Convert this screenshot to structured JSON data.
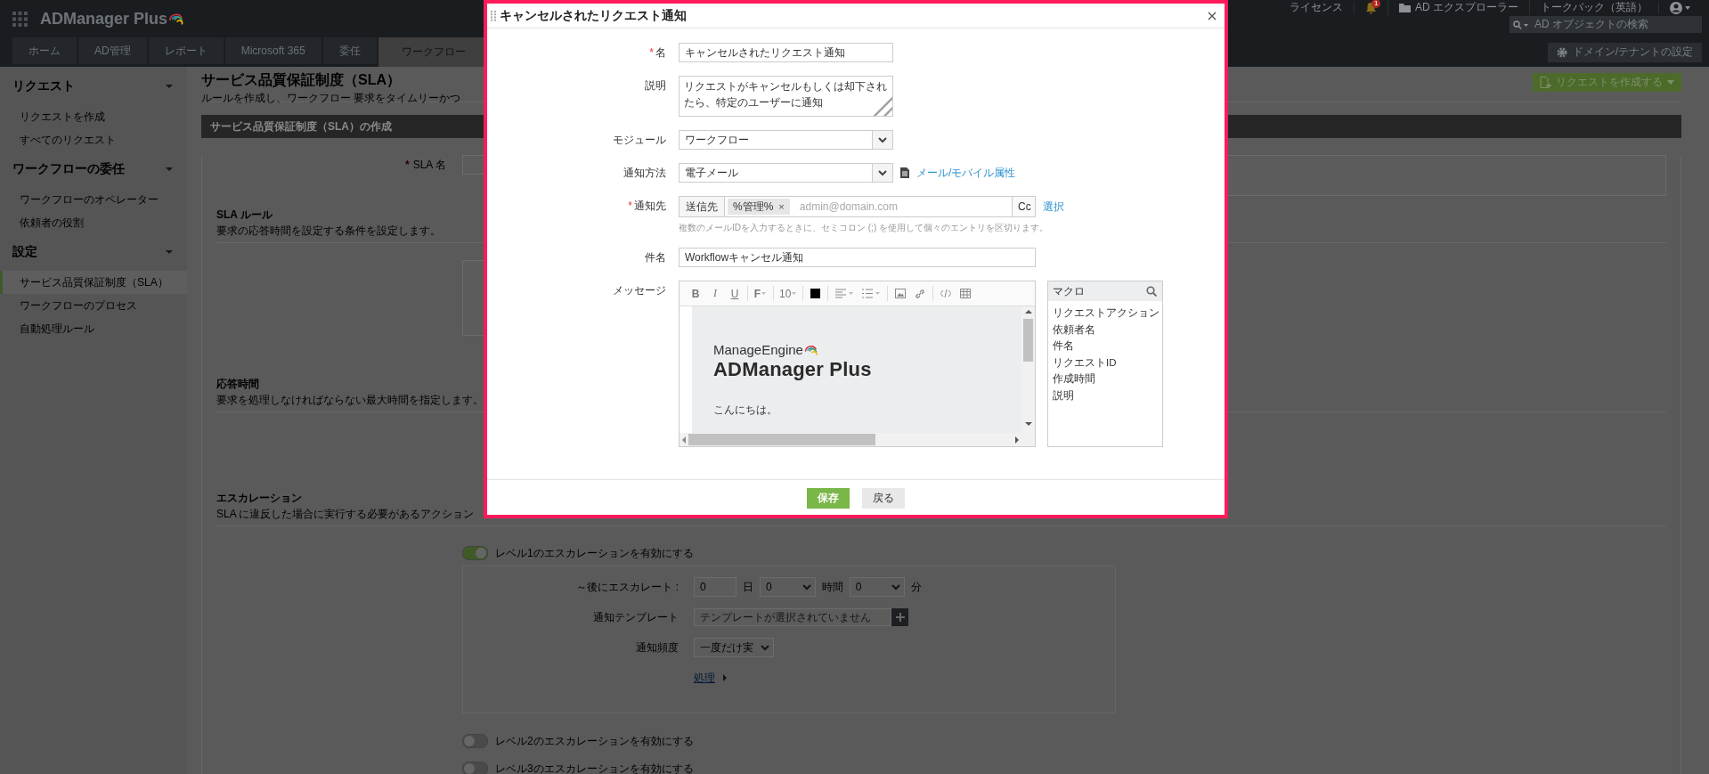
{
  "header": {
    "app_name": "ADManager Plus",
    "links": [
      {
        "kind": "text",
        "label": "ライセンス"
      },
      {
        "kind": "bell",
        "badge": "1"
      },
      {
        "kind": "folder",
        "label": "AD エクスプローラー"
      },
      {
        "kind": "text",
        "label": "トークバック（英語）"
      },
      {
        "kind": "user"
      }
    ],
    "search": {
      "placeholder": "AD オブジェクトの検索"
    }
  },
  "tabs": [
    {
      "label": "ホーム",
      "selected": false
    },
    {
      "label": "AD管理",
      "selected": false
    },
    {
      "label": "レポート",
      "selected": false
    },
    {
      "label": "Microsoft 365",
      "selected": false
    },
    {
      "label": "委任",
      "selected": false
    },
    {
      "label": "ワークフロー",
      "selected": true
    }
  ],
  "domain_button": "ドメイン/テナントの設定",
  "sidebar": {
    "sections": [
      {
        "title": "リクエスト",
        "expanded": true,
        "items": [
          {
            "label": "リクエストを作成",
            "selected": false
          },
          {
            "label": "すべてのリクエスト",
            "selected": false
          }
        ]
      },
      {
        "title": "ワークフローの委任",
        "expanded": true,
        "items": [
          {
            "label": "ワークフローのオペレーター",
            "selected": false
          },
          {
            "label": "依頼者の役割",
            "selected": false
          }
        ]
      },
      {
        "title": "設定",
        "expanded": true,
        "items": [
          {
            "label": "サービス品質保証制度（SLA）",
            "selected": true
          },
          {
            "label": "ワークフローのプロセス",
            "selected": false
          },
          {
            "label": "自動処理ルール",
            "selected": false
          }
        ]
      }
    ]
  },
  "page": {
    "title": "サービス品質保証制度（SLA）",
    "subtitle": "ルールを作成し、ワークフロー 要求をタイムリーかつ",
    "create_button": "リクエストを作成する",
    "panel_title": "サービス品質保証制度（SLA）の作成",
    "sla_name": {
      "required_mark": "*",
      "label": "SLA 名"
    },
    "sections": [
      {
        "title": "SLA ルール",
        "subtitle": "要求の応答時間を設定する条件を設定します。"
      },
      {
        "title": "応答時間",
        "subtitle": "要求を処理しなければならない最大時間を指定します。"
      },
      {
        "title": "エスカレーション",
        "subtitle": "SLA に違反した場合に実行する必要があるアクション"
      }
    ],
    "escalations": [
      {
        "label": "レベル1のエスカレーションを有効にする",
        "on": true
      },
      {
        "label": "レベル2のエスカレーションを有効にする",
        "on": false
      },
      {
        "label": "レベル3のエスカレーションを有効にする",
        "on": false
      }
    ],
    "escalation_detail": {
      "after_label": "～後にエスカレート :",
      "days": "0",
      "days_unit": "日",
      "hours": "0",
      "hours_unit": "時間",
      "minutes": "0",
      "minutes_unit": "分",
      "template_label": "通知テンプレート",
      "template_placeholder": "テンプレートが選択されていません",
      "frequency_label": "通知頻度",
      "frequency_value": "一度だけ実",
      "action_link": "処理"
    }
  },
  "dialog": {
    "title": "キャンセルされたリクエスト通知",
    "fields": [
      {
        "kind": "input",
        "required_mark": "*",
        "label": "名",
        "value": "キャンセルされたリクエスト通知"
      },
      {
        "kind": "textarea",
        "label": "説明",
        "value": "リクエストがキャンセルもしくは却下されたら、特定のユーザーに通知"
      },
      {
        "kind": "select",
        "label": "モジュール",
        "value": "ワークフロー"
      },
      {
        "kind": "select",
        "label": "通知方法",
        "value": "電子メール",
        "link": "メール/モバイル属性"
      },
      {
        "kind": "recipients",
        "required_mark": "*",
        "label": "通知先",
        "prefix": "送信先",
        "chips": [
          {
            "label": "%管理%",
            "remove": "×"
          }
        ],
        "placeholder": "admin@domain.com",
        "cc": "Cc",
        "link": "選択",
        "hint": "複数のメールIDを入力するときに、セミコロン (;) を使用して個々のエントリを区切ります。"
      },
      {
        "kind": "input",
        "wide": true,
        "label": "件名",
        "value": "Workflowキャンセル通知"
      },
      {
        "kind": "editor",
        "label": "メッセージ"
      }
    ],
    "toolbar": [
      [
        {
          "kind": "bold",
          "label": "B"
        },
        {
          "kind": "italic",
          "label": "I"
        },
        {
          "kind": "underline",
          "label": "U"
        }
      ],
      [
        {
          "kind": "font",
          "label": "F"
        }
      ],
      [
        {
          "kind": "size",
          "label": "10"
        }
      ],
      [
        {
          "kind": "color"
        }
      ],
      [
        {
          "kind": "align"
        },
        {
          "kind": "list"
        }
      ],
      [
        {
          "kind": "image"
        },
        {
          "kind": "link"
        }
      ],
      [
        {
          "kind": "code"
        },
        {
          "kind": "table"
        }
      ]
    ],
    "preview": {
      "brand": "ManageEngine",
      "product": "ADManager Plus",
      "greeting": "こんにちは。"
    },
    "macros": {
      "title": "マクロ",
      "items": [
        "リクエストアクション",
        "依頼者名",
        "件名",
        "リクエストID",
        "作成時間",
        "説明"
      ]
    },
    "buttons": [
      {
        "kind": "primary",
        "label": "保存"
      },
      {
        "kind": "secondary",
        "label": "戻る"
      }
    ]
  }
}
